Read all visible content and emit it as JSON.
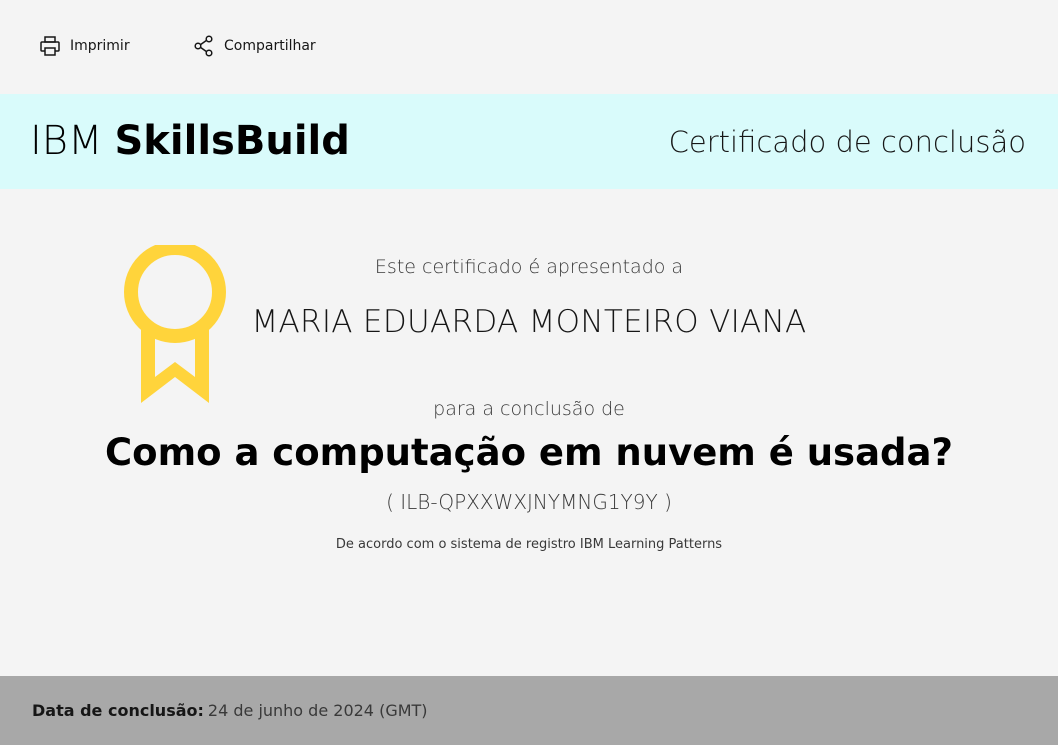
{
  "toolbar": {
    "print": {
      "label": "Imprimir",
      "icon": "printer-icon"
    },
    "share": {
      "label": "Compartilhar",
      "icon": "share-icon"
    }
  },
  "header": {
    "brand_ibm": "IBM",
    "brand_name": "SkillsBuild",
    "certificate_type": "Certificado de conclusão",
    "background_color": "#d9fbfb"
  },
  "certificate": {
    "badge_icon": "award-ribbon-icon",
    "badge_color": "#ffd43b",
    "presented_to_text": "Este certificado é apresentado a",
    "recipient_name": "MARIA EDUARDA MONTEIRO VIANA",
    "completion_of_text": "para a conclusão de",
    "course_title": "Como a computação em nuvem é usada?",
    "course_id": "( ILB-QPXXWXJNYMNG1Y9Y )",
    "registry_note": "De acordo com o sistema de registro IBM Learning Patterns"
  },
  "footer": {
    "completion_date_label": "Data de conclusão:",
    "completion_date_value": "24 de junho de 2024 (GMT)",
    "background_color": "#a8a8a8"
  }
}
